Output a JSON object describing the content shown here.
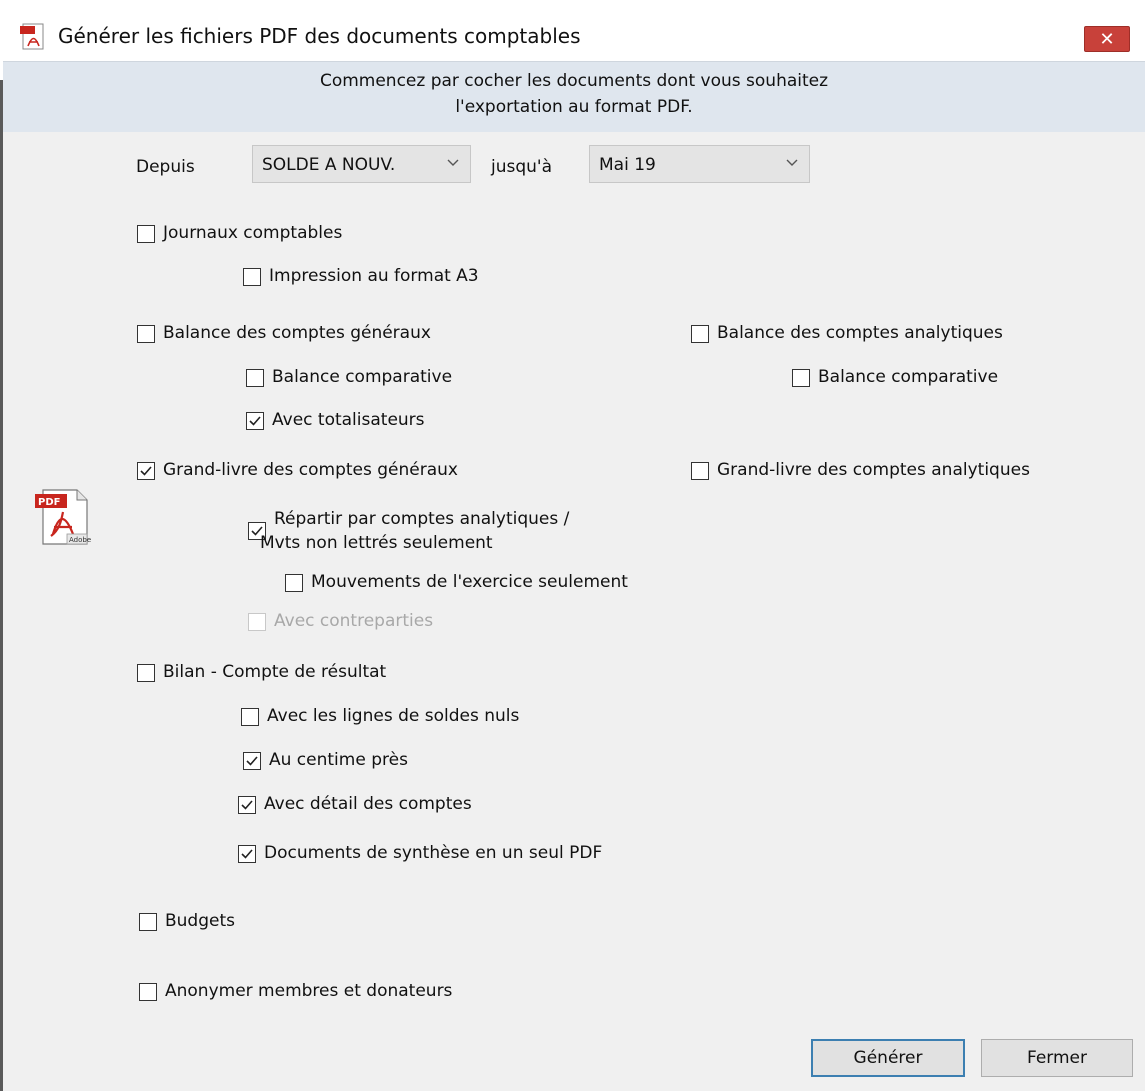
{
  "window": {
    "title": "Générer les fichiers PDF des documents comptables",
    "close_label": "✕"
  },
  "banner": {
    "line1": "Commencez par cocher les documents dont vous souhaitez",
    "line2": "l'exportation au format PDF."
  },
  "period": {
    "from_label": "Depuis",
    "from_value": "SOLDE A NOUV.",
    "to_label": "jusqu'à",
    "to_value": "Mai 19"
  },
  "options": {
    "journaux": {
      "label": "Journaux comptables",
      "checked": false
    },
    "impression_a3": {
      "label": "Impression au format A3",
      "checked": false
    },
    "balance_generaux": {
      "label": "Balance des comptes généraux",
      "checked": false
    },
    "balance_comparative_gen": {
      "label": "Balance comparative",
      "checked": false
    },
    "avec_totalisateurs": {
      "label": "Avec totalisateurs",
      "checked": true
    },
    "balance_analytiques": {
      "label": "Balance des comptes analytiques",
      "checked": false
    },
    "balance_comparative_ana": {
      "label": "Balance comparative",
      "checked": false
    },
    "grand_livre_generaux": {
      "label": "Grand-livre des comptes généraux",
      "checked": true
    },
    "repartir_line1": "Répartir par comptes analytiques /",
    "repartir_line2": "Mvts non lettrés seulement",
    "repartir_checked": true,
    "mouvements_exercice": {
      "label": "Mouvements de l'exercice seulement",
      "checked": false
    },
    "avec_contreparties": {
      "label": "Avec contreparties",
      "checked": false,
      "disabled": true
    },
    "grand_livre_analytiques": {
      "label": "Grand-livre des comptes analytiques",
      "checked": false
    },
    "bilan": {
      "label": "Bilan - Compte de résultat",
      "checked": false
    },
    "soldes_nuls": {
      "label": "Avec les lignes de soldes nuls",
      "checked": false
    },
    "centime": {
      "label": "Au centime près",
      "checked": true
    },
    "detail_comptes": {
      "label": "Avec détail des comptes",
      "checked": true
    },
    "synthese": {
      "label": "Documents de synthèse en un seul PDF",
      "checked": true
    },
    "budgets": {
      "label": "Budgets",
      "checked": false
    },
    "anonymer": {
      "label": "Anonymer membres et donateurs",
      "checked": false
    }
  },
  "buttons": {
    "generer": "Générer",
    "fermer": "Fermer"
  },
  "icons": {
    "title_icon": "pdf-document-icon",
    "side_icon": "adobe-pdf-icon",
    "dropdown": "chevron-down-icon",
    "check": "checkmark-icon"
  },
  "colors": {
    "banner_bg": "#dfe6ee",
    "close_bg": "#c8413a",
    "default_button_border": "#3c7fb1",
    "pdf_red": "#c8261e"
  }
}
